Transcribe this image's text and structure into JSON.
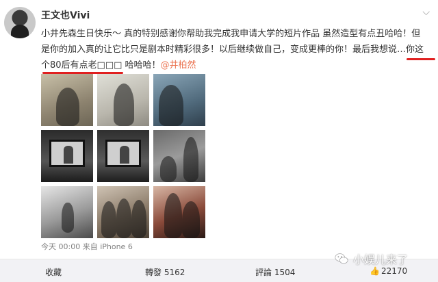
{
  "post": {
    "username": "王文也Vivi",
    "lines": [
      "小井先森生日快乐～ 真的特别感谢你帮助我完成我申请大学的短片作品 虽然造型有点丑哈哈！但",
      "是你的加入真的让它比只是剧本时精彩很多！以后继续做自己，变成更棒的你！最后我想说…你这",
      "个80后有点老□□□ 哈哈哈！"
    ],
    "mention": "@井柏然",
    "meta": "今天 00:00 来自 iPhone 6"
  },
  "actions": {
    "favorite": "收藏",
    "repost": "轉發 5162",
    "comment": "評論 1504",
    "like": "22170"
  },
  "icons": {
    "menu": "chevron-down-icon",
    "like": "thumbs-up-icon",
    "watermark": "wechat-icon"
  },
  "watermark": {
    "text": "小娱儿来了"
  },
  "colors": {
    "mention": "#eb7350",
    "underline": "#e02020",
    "action_bar": "#f2f2f5"
  }
}
